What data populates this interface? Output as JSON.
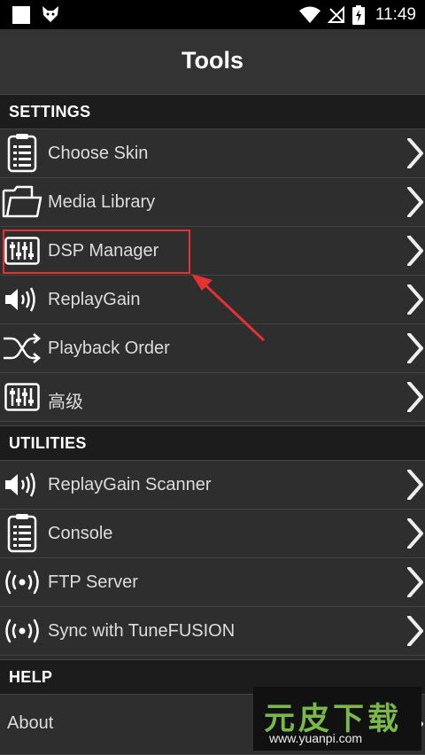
{
  "status_bar": {
    "time": "11:49"
  },
  "header": {
    "title": "Tools"
  },
  "sections": {
    "settings": "SETTINGS",
    "utilities": "UTILITIES",
    "help": "HELP"
  },
  "settings_items": [
    {
      "label": "Choose Skin",
      "icon": "clipboard-list-icon"
    },
    {
      "label": "Media Library",
      "icon": "folder-icon"
    },
    {
      "label": "DSP Manager",
      "icon": "equalizer-icon"
    },
    {
      "label": "ReplayGain",
      "icon": "speaker-icon"
    },
    {
      "label": "Playback Order",
      "icon": "shuffle-icon"
    },
    {
      "label": "高级",
      "icon": "equalizer-icon"
    }
  ],
  "utilities_items": [
    {
      "label": "ReplayGain Scanner",
      "icon": "speaker-icon"
    },
    {
      "label": "Console",
      "icon": "clipboard-list-icon"
    },
    {
      "label": "FTP Server",
      "icon": "broadcast-icon"
    },
    {
      "label": "Sync with TuneFUSION",
      "icon": "broadcast-icon"
    }
  ],
  "help_items": [
    {
      "label": "About"
    }
  ],
  "watermark": {
    "name": "元皮下载",
    "url": "www.yuanpi.com"
  },
  "colors": {
    "highlight": "#e5312f",
    "watermark_green": "#7ab84a"
  }
}
